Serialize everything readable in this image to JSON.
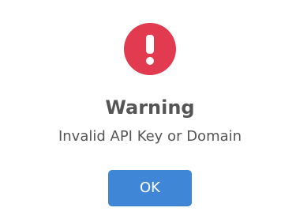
{
  "dialog": {
    "title": "Warning",
    "message": "Invalid API Key or Domain",
    "confirm_label": "OK",
    "icon": "exclamation-circle-icon",
    "accent_color": "#e23a4e",
    "button_color": "#3f87d6"
  }
}
